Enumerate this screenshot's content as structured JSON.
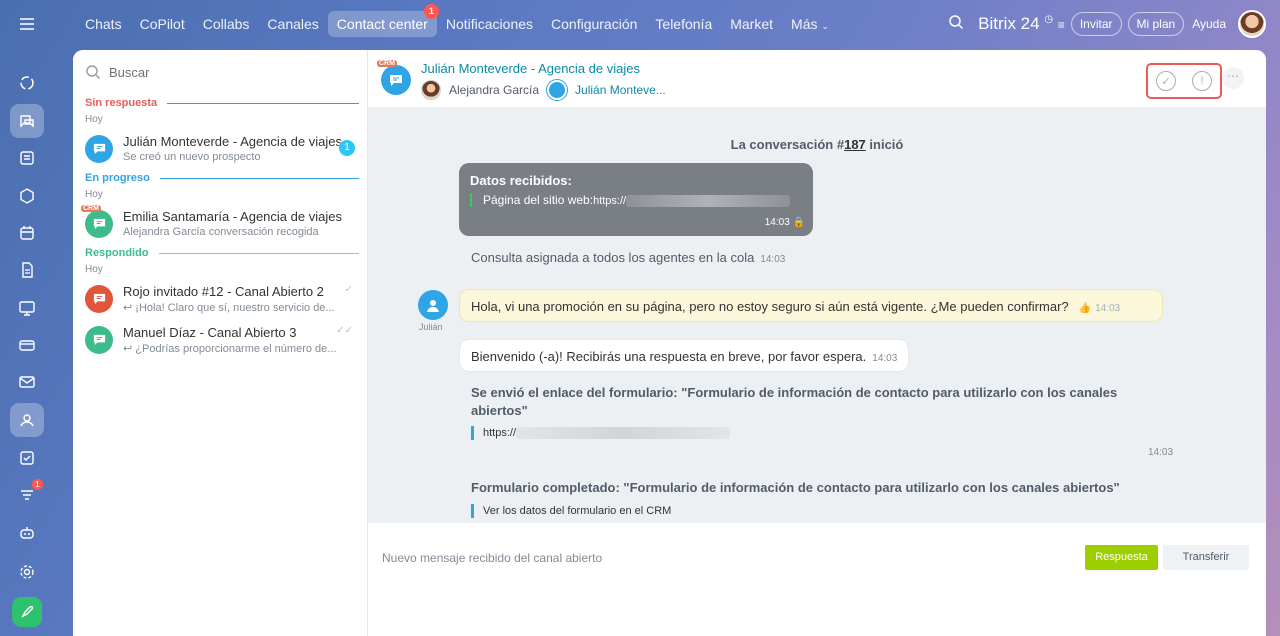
{
  "topnav": {
    "items": [
      "Chats",
      "CoPilot",
      "Collabs",
      "Canales",
      "Contact center",
      "Notificaciones",
      "Configuración",
      "Telefonía",
      "Market",
      "Más"
    ],
    "active_badge": "1",
    "brand": "Bitrix 24",
    "invite": "Invitar",
    "my_plan": "Mi plan",
    "help": "Ayuda"
  },
  "rail": {
    "tasks_badge": "1"
  },
  "list": {
    "search_placeholder": "Buscar",
    "groups": [
      {
        "title": "Sin respuesta",
        "color": "#e85b5b",
        "day": "Hoy",
        "items": [
          {
            "title": "Julián Monteverde - Agencia de viajes",
            "sub": "Se creó un nuevo prospecto",
            "unread": "1",
            "color": "#2fa5e6"
          }
        ]
      },
      {
        "title": "En progreso",
        "color": "#2fa5e6",
        "day": "Hoy",
        "items": [
          {
            "title": "Emilia Santamaría - Agencia de viajes",
            "sub": "Alejandra García conversación recogida",
            "crm": "CRM",
            "color": "#3dbb8a"
          }
        ]
      },
      {
        "title": "Respondido",
        "color": "#3dbb8a",
        "day": "Hoy",
        "items": [
          {
            "title": "Rojo invitado #12 - Canal Abierto 2",
            "sub": "¡Hola! Claro que sí, nuestro servicio de...",
            "color": "#e2553a"
          },
          {
            "title": "Manuel Díaz - Canal Abierto 3",
            "sub": "¿Podrías proporcionarme el número de...",
            "color": "#3dbb8a"
          }
        ]
      }
    ]
  },
  "dialog": {
    "crm_tag": "CRM",
    "title": "Julián Monteverde - Agencia de viajes",
    "member1": "Alejandra García",
    "member2": "Julián Monteve...",
    "started_prefix": "La conversación #",
    "started_number": "187",
    "started_suffix": " inició",
    "data_title": "Datos recibidos:",
    "data_line": "Página del sitio web:",
    "data_url": "https://",
    "data_time": "14:03",
    "assigned": "Consulta asignada a todos los agentes en la cola",
    "assigned_time": "14:03",
    "client_name": "Julián",
    "client_msg": "Hola, vi una promoción en su página, pero no estoy seguro si aún está vigente. ¿Me pueden confirmar?",
    "client_time": "14:03",
    "bot_msg": "Bienvenido (-a)! Recibirás una respuesta en breve, por favor espera.",
    "bot_time": "14:03",
    "form_sent": "Se envió el enlace del formulario: \"Formulario de información de contacto para utilizarlo con los canales abiertos\"",
    "form_sent_url": "https://",
    "form_sent_time": "14:03",
    "form_done": "Formulario completado: \"Formulario de información de contacto para utilizarlo con los canales abiertos\"",
    "form_done_link": "Ver los datos del formulario en el CRM"
  },
  "footer": {
    "notice": "Nuevo mensaje recibido del canal abierto",
    "answer": "Respuesta",
    "transfer": "Transferir"
  }
}
